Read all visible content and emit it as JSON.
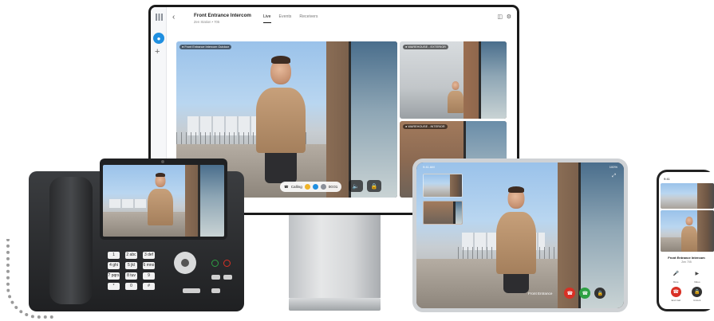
{
  "app": {
    "title": "Front Entrance Intercom",
    "subtitle": "Zen Station • 705",
    "tabs": [
      "Live",
      "Events",
      "Receivers"
    ],
    "active_tab": "Live",
    "rail_avatar_icon": "user-icon"
  },
  "feeds": {
    "main_label": "● Front Entrance Intercom Outdoor",
    "side1_label": "● WAREHOUSE - EXTERIOR",
    "side2_label": "● WAREHOUSE - INTERIOR"
  },
  "call": {
    "status": "Calling",
    "timer": "00:01"
  },
  "desk_phone": {
    "keys": [
      "1",
      "2 abc",
      "3 def",
      "4 ghi",
      "5 jkl",
      "6 mno",
      "7 pqrs",
      "8 tuv",
      "9 wxyz",
      "*",
      "0",
      "#"
    ]
  },
  "tablet": {
    "time": "9:41 AM",
    "battery": "100%",
    "caller": "Front Entrance"
  },
  "smartphone": {
    "time": "9:41",
    "title": "Front Entrance Intercom",
    "subtitle": "Zen 705",
    "row1": [
      "Mute",
      "Video"
    ],
    "row2": [
      "End Call",
      "Unlock"
    ]
  },
  "colors": {
    "accent": "#1f8fe0",
    "accept_green": "#2ea043",
    "decline_red": "#d93025"
  }
}
